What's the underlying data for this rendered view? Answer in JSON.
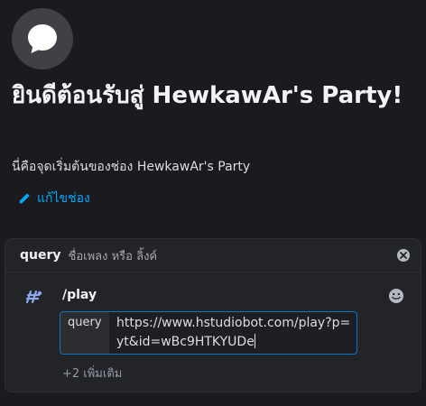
{
  "welcome": {
    "title": "ยินดีต้อนรับสู่ HewkawAr's Party!",
    "description": "นี่คือจุดเริ่มต้นของช่อง HewkawAr's Party",
    "edit_channel_label": "แก้ไขช่อง",
    "channel_icon": "chat-bubble-icon",
    "edit_icon": "pencil-icon"
  },
  "command_panel": {
    "option_name": "query",
    "option_description": "ชื่อเพลง หรือ ลิ้งค์",
    "command": "/play",
    "query_label": "query",
    "query_value": "https://www.hstudiobot.com/play?p=yt&id=wBc9HTKYUDe",
    "more_options": "+2 เพิ่มเติม",
    "icons": [
      "close-icon",
      "bot-avatar-icon",
      "emoji-icon"
    ]
  },
  "colors": {
    "background": "#1b1b1f",
    "panel": "#232428",
    "link": "#00a8fc",
    "focus_border": "#0b78c5"
  }
}
